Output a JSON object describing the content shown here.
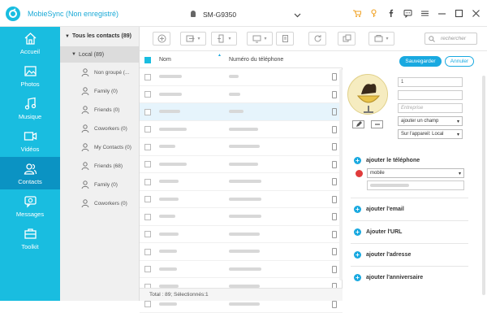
{
  "app": {
    "title": "MobieSync (Non enregistré)"
  },
  "device": {
    "name": "SM-G9350"
  },
  "window_icons": [
    "cart-icon",
    "key-icon",
    "facebook-icon",
    "chat-icon",
    "menu-icon",
    "minimize-icon",
    "maximize-icon",
    "close-icon"
  ],
  "nav": {
    "items": [
      {
        "label": "Accueil",
        "icon": "home-icon"
      },
      {
        "label": "Photos",
        "icon": "photos-icon"
      },
      {
        "label": "Musique",
        "icon": "music-icon"
      },
      {
        "label": "Vidéos",
        "icon": "video-icon"
      },
      {
        "label": "Contacts",
        "icon": "contacts-icon",
        "active": true
      },
      {
        "label": "Messages",
        "icon": "messages-icon"
      },
      {
        "label": "Toolkit",
        "icon": "toolkit-icon"
      }
    ]
  },
  "tree": {
    "all": "Tous les contacts  (89)",
    "local": "Local  (89)",
    "groups": [
      {
        "label": "Non groupé  (..."
      },
      {
        "label": "Family  (0)"
      },
      {
        "label": "Friends  (0)"
      },
      {
        "label": "Coworkers  (0)"
      },
      {
        "label": "My Contacts  (0)"
      },
      {
        "label": "Friends  (68)"
      },
      {
        "label": "Family  (0)"
      },
      {
        "label": "Coworkers  (0)"
      }
    ]
  },
  "toolbar": {
    "buttons": [
      "add-icon",
      "import-icon",
      "export-icon",
      "transfer-icon",
      "delete-icon",
      "refresh-icon",
      "duplicate-icon",
      "backup-icon"
    ],
    "search_placeholder": "rechercher"
  },
  "list": {
    "col_name": "Nom",
    "col_phone": "Numéro du téléphone",
    "rows": 14,
    "selected_row": 3,
    "footer": "Total : 89; Sélectionnés:1"
  },
  "detail": {
    "save": "Sauvegarder",
    "cancel": "Annuler",
    "field1": "1",
    "field3_placeholder": "Entreprise",
    "add_field": "ajouter un champ",
    "device_store": "Sur l'appareil: Local",
    "add_phone": "ajouter le téléphone",
    "phone_type": "mobile",
    "add_email": "ajouter l'email",
    "add_url": "Ajouter l'URL",
    "add_address": "ajouter l'adresse",
    "add_birthday": "ajouter l'anniversaire"
  },
  "colors": {
    "accent": "#19bde0",
    "accent_dark": "#0b93c3",
    "button_blue": "#19a9e0",
    "danger": "#e03b3b"
  }
}
